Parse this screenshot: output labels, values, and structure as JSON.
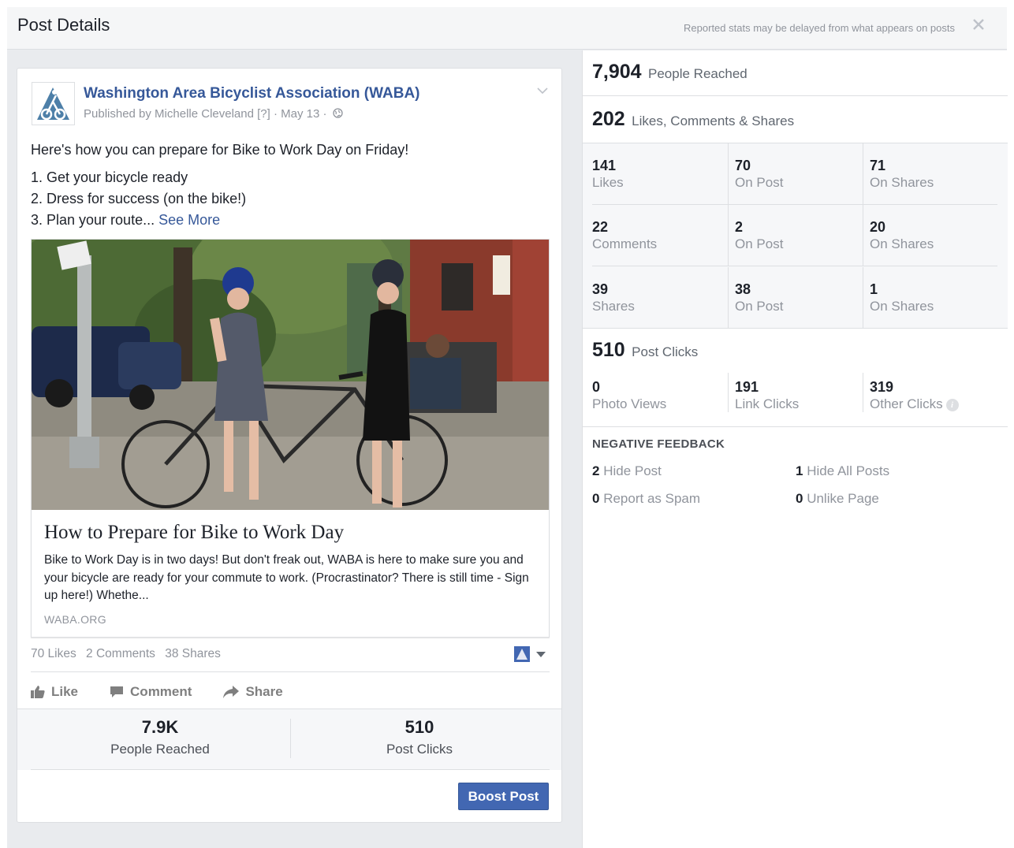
{
  "header": {
    "title": "Post Details",
    "note": "Reported stats may be delayed from what appears on posts",
    "close_icon": "close-icon"
  },
  "post": {
    "page_name": "Washington Area Bicyclist Association (WABA)",
    "byline": "Published by Michelle Cleveland [?] · May 13 ·",
    "text_line1": "Here's how you can prepare for Bike to Work Day on Friday!",
    "text_line2": "1. Get your bicycle ready",
    "text_line3": "2. Dress for success (on the bike!)",
    "text_line4": "3. Plan your route...",
    "see_more": "See More",
    "link": {
      "title": "How to Prepare for Bike to Work Day",
      "description": "Bike to Work Day is in two days! But don't freak out, WABA is here to make sure you and your bicycle are ready for your commute to work. (Procrastinator? There is still time - Sign up here!) Whethe...",
      "domain": "WABA.ORG"
    },
    "counts": {
      "likes": "70 Likes",
      "comments": "2 Comments",
      "shares": "38 Shares"
    },
    "actions": {
      "like": "Like",
      "comment": "Comment",
      "share": "Share"
    },
    "summary": {
      "reached_value": "7.9K",
      "reached_label": "People Reached",
      "clicks_value": "510",
      "clicks_label": "Post Clicks"
    },
    "boost_label": "Boost Post"
  },
  "insights": {
    "reached": {
      "value": "7,904",
      "label": "People Reached"
    },
    "engagement": {
      "value": "202",
      "label": "Likes, Comments & Shares"
    },
    "grid": [
      [
        {
          "value": "141",
          "label": "Likes"
        },
        {
          "value": "70",
          "label": "On Post"
        },
        {
          "value": "71",
          "label": "On Shares"
        }
      ],
      [
        {
          "value": "22",
          "label": "Comments"
        },
        {
          "value": "2",
          "label": "On Post"
        },
        {
          "value": "20",
          "label": "On Shares"
        }
      ],
      [
        {
          "value": "39",
          "label": "Shares"
        },
        {
          "value": "38",
          "label": "On Post"
        },
        {
          "value": "1",
          "label": "On Shares"
        }
      ]
    ],
    "clicks": {
      "value": "510",
      "label": "Post Clicks",
      "breakdown": [
        {
          "value": "0",
          "label": "Photo Views"
        },
        {
          "value": "191",
          "label": "Link Clicks"
        },
        {
          "value": "319",
          "label": "Other Clicks"
        }
      ]
    },
    "negative": {
      "title": "NEGATIVE FEEDBACK",
      "hide_post": {
        "value": "2",
        "label": "Hide Post"
      },
      "hide_all": {
        "value": "1",
        "label": "Hide All Posts"
      },
      "spam": {
        "value": "0",
        "label": "Report as Spam"
      },
      "unlike": {
        "value": "0",
        "label": "Unlike Page"
      }
    }
  },
  "colors": {
    "link_blue": "#365899",
    "button_blue": "#4267b2",
    "muted": "#90949c"
  }
}
